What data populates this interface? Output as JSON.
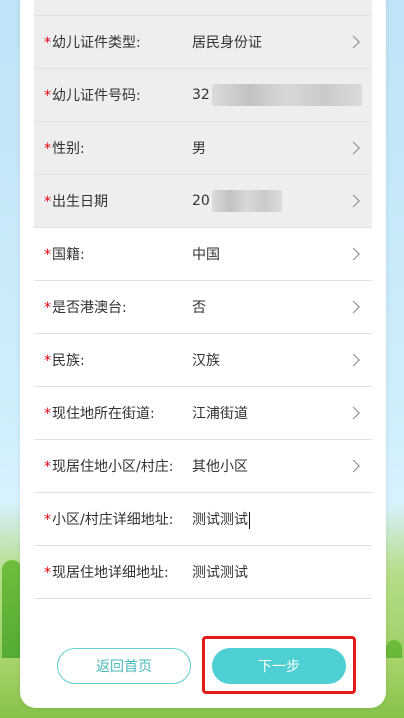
{
  "form": {
    "rows": [
      {
        "label": "幼儿证件类型:",
        "value": "居民身份证",
        "value_suffix": ""
      },
      {
        "label": "幼儿证件号码:",
        "value": "32",
        "value_suffix": ""
      },
      {
        "label": "性别:",
        "value": "男",
        "value_suffix": ""
      },
      {
        "label": "出生日期",
        "value": "20",
        "value_suffix": ""
      },
      {
        "label": "国籍:",
        "value": "中国",
        "value_suffix": ""
      },
      {
        "label": "是否港澳台:",
        "value": "否",
        "value_suffix": ""
      },
      {
        "label": "民族:",
        "value": "汉族",
        "value_suffix": ""
      },
      {
        "label": "现住地所在街道:",
        "value": "江浦街道",
        "value_suffix": ""
      },
      {
        "label": "现居住地小区/村庄:",
        "value": "其他小区",
        "value_suffix": ""
      },
      {
        "label": "小区/村庄详细地址:",
        "value": "测试测试",
        "value_suffix": ""
      },
      {
        "label": "现居住地详细地址:",
        "value": "测试测试",
        "value_suffix": ""
      }
    ],
    "required_mark": "*"
  },
  "buttons": {
    "back_label": "返回首页",
    "next_label": "下一步"
  },
  "colors": {
    "required": "#e60012",
    "accent": "#4ecfd3",
    "highlight": "#e31b1b"
  }
}
